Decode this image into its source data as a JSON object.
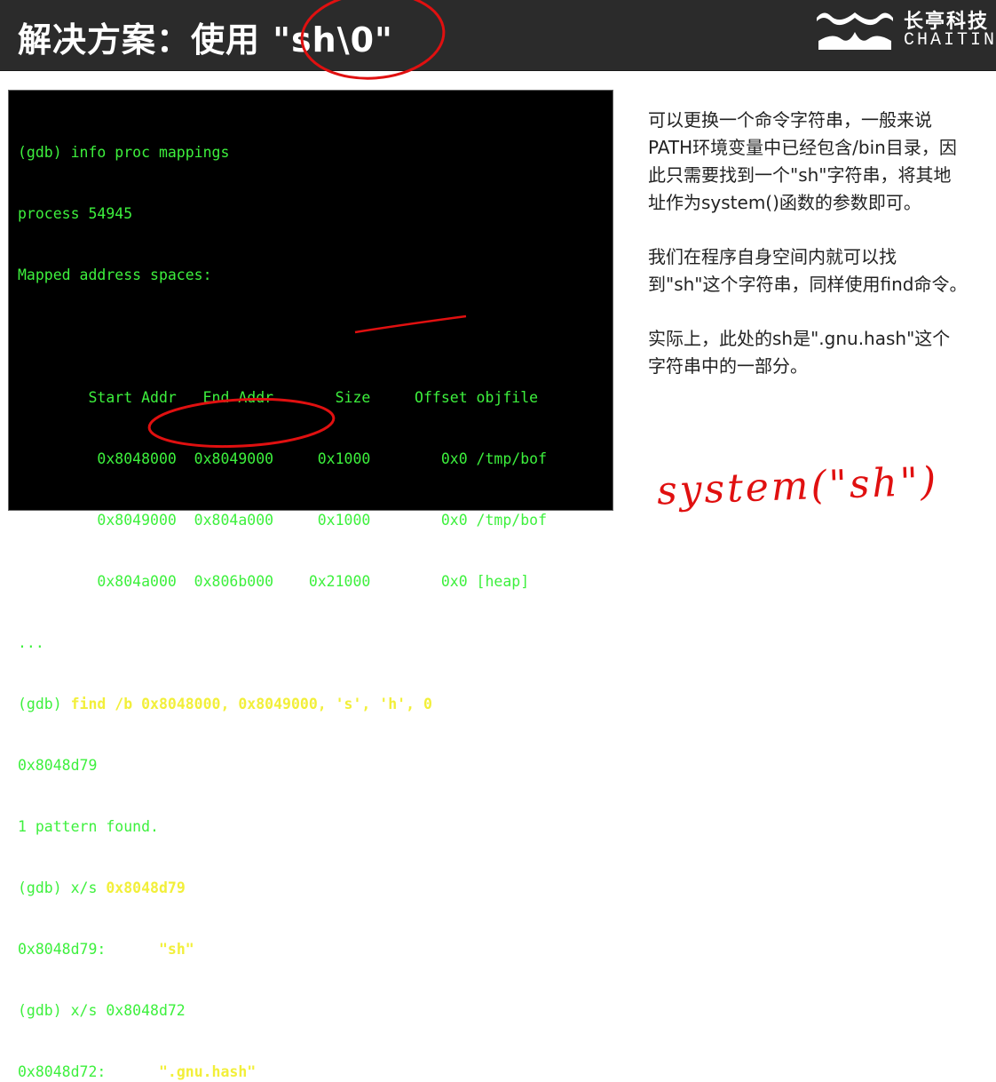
{
  "header": {
    "title": "解决方案：使用 \"sh\\0\"",
    "logo_cn": "长亭科技",
    "logo_en": "CHAITIN"
  },
  "terminal": {
    "lines": [
      {
        "text": "(gdb) info proc mappings"
      },
      {
        "text": "process 54945"
      },
      {
        "text": "Mapped address spaces:"
      },
      {
        "text": ""
      },
      {
        "text": "        Start Addr   End Addr       Size     Offset objfile"
      },
      {
        "text": "         0x8048000  0x8049000     0x1000        0x0 /tmp/bof"
      },
      {
        "text": "         0x8049000  0x804a000     0x1000        0x0 /tmp/bof"
      },
      {
        "text": "         0x804a000  0x806b000    0x21000        0x0 [heap]"
      },
      {
        "text": "..."
      },
      {
        "prefix": "(gdb) ",
        "highlight": "find /b 0x8048000, 0x8049000, 's', 'h', 0"
      },
      {
        "text": "0x8048d79"
      },
      {
        "text": "1 pattern found."
      },
      {
        "prefix": "(gdb) x/s ",
        "highlight": "0x8048d79"
      },
      {
        "prefix": "0x8048d79:      ",
        "highlight": "\"sh\""
      },
      {
        "text": "(gdb) x/s 0x8048d72"
      },
      {
        "prefix": "0x8048d72:      ",
        "highlight": "\".gnu.hash\""
      }
    ]
  },
  "notes": {
    "p1": "可以更换一个命令字符串，一般来说PATH环境变量中已经包含/bin目录，因此只需要找到一个\"sh\"字符串，将其地址作为system()函数的参数即可。",
    "p2": "我们在程序自身空间内就可以找到\"sh\"这个字符串，同样使用find命令。",
    "p3": "实际上，此处的sh是\".gnu.hash\"这个字符串中的一部分。"
  },
  "annotation": {
    "handwriting": "system(\"sh\")",
    "ink_color": "#e01010"
  }
}
